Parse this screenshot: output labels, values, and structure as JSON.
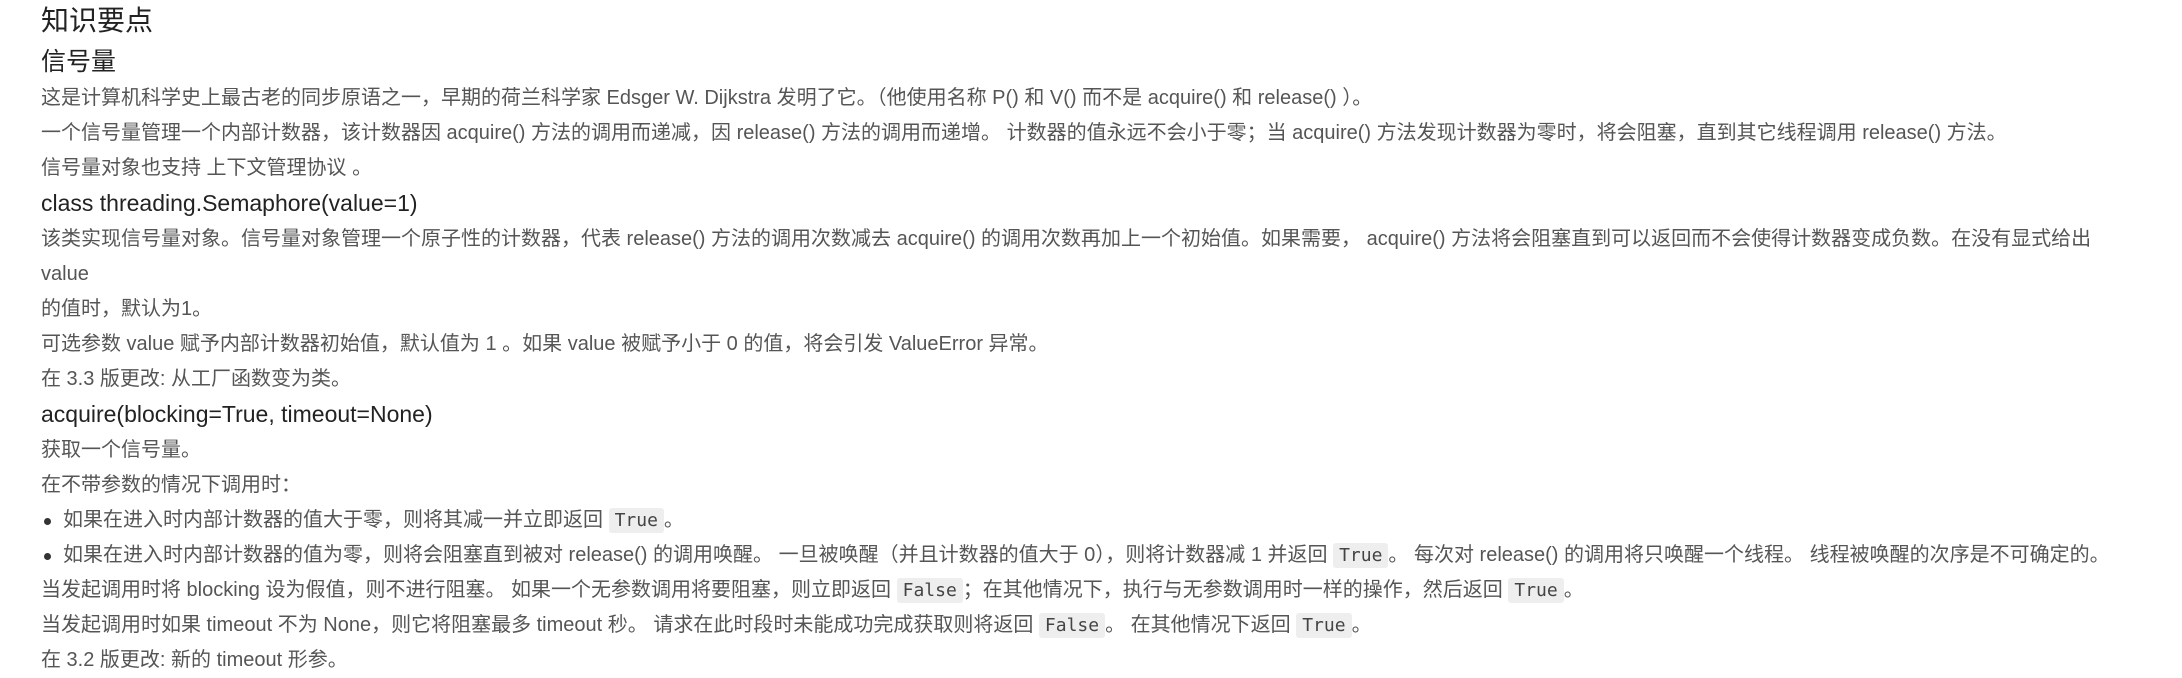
{
  "title": "知识要点",
  "section": "信号量",
  "intro": [
    "这是计算机科学史上最古老的同步原语之一，早期的荷兰科学家 Edsger W. Dijkstra 发明了它。（他使用名称 P() 和 V() 而不是 acquire() 和 release() ）。",
    "一个信号量管理一个内部计数器，该计数器因 acquire() 方法的调用而递减，因 release() 方法的调用而递增。 计数器的值永远不会小于零；当 acquire() 方法发现计数器为零时，将会阻塞，直到其它线程调用 release() 方法。",
    "信号量对象也支持 上下文管理协议 。"
  ],
  "class_sig": "class threading.Semaphore(value=1)",
  "class_desc": [
    "该类实现信号量对象。信号量对象管理一个原子性的计数器，代表 release() 方法的调用次数减去 acquire() 的调用次数再加上一个初始值。如果需要， acquire() 方法将会阻塞直到可以返回而不会使得计数器变成负数。在没有显式给出 value",
    "的值时，默认为1。",
    "可选参数 value 赋予内部计数器初始值，默认值为 1 。如果 value 被赋予小于 0 的值，将会引发 ValueError 异常。",
    "在 3.3 版更改: 从工厂函数变为类。"
  ],
  "acquire_sig": "acquire(blocking=True, timeout=None)",
  "acquire_desc": {
    "p1": "获取一个信号量。",
    "p2": "在不带参数的情况下调用时：",
    "li1_a": "如果在进入时内部计数器的值大于零，则将其减一并立即返回 ",
    "li1_code": "True",
    "li1_b": "。",
    "li2_a": "如果在进入时内部计数器的值为零，则将会阻塞直到被对 release() 的调用唤醒。 一旦被唤醒（并且计数器的值大于 0），则将计数器减 1 并返回 ",
    "li2_code": "True",
    "li2_b": "。 每次对 release() 的调用将只唤醒一个线程。 线程被唤醒的次序是不可确定的。",
    "p3_a": "当发起调用时将 blocking 设为假值，则不进行阻塞。 如果一个无参数调用将要阻塞，则立即返回 ",
    "p3_code1": "False",
    "p3_b": "；在其他情况下，执行与无参数调用时一样的操作，然后返回 ",
    "p3_code2": "True",
    "p3_c": "。",
    "p4_a": "当发起调用时如果 timeout 不为 None，则它将阻塞最多 timeout 秒。 请求在此时段时未能成功完成获取则将返回 ",
    "p4_code1": "False",
    "p4_b": "。 在其他情况下返回 ",
    "p4_code2": "True",
    "p4_c": "。",
    "p5": "在 3.2 版更改: 新的 timeout 形参。"
  }
}
